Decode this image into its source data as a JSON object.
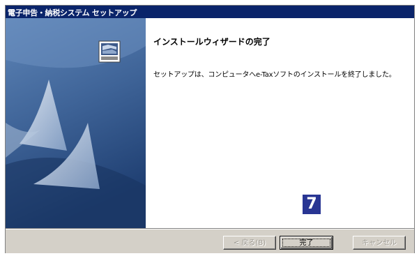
{
  "window": {
    "title": "電子申告・納税システム セットアップ"
  },
  "wizard": {
    "heading": "インストールウィザードの完了",
    "message": "セットアップは、コンピュータへe-Taxソフトのインストールを終了しました。"
  },
  "annotation": {
    "step_number": "7"
  },
  "buttons": {
    "back_label": "< 戻る(B)",
    "finish_label": "完了",
    "cancel_label": "キャンセル"
  },
  "colors": {
    "titlebar": "#0a246a",
    "side_panel_top": "#4a6fa3",
    "side_panel_bottom": "#1f3f72",
    "badge": "#283593"
  },
  "icons": {
    "computer": "computer-icon",
    "sails": "sail-graphic"
  }
}
